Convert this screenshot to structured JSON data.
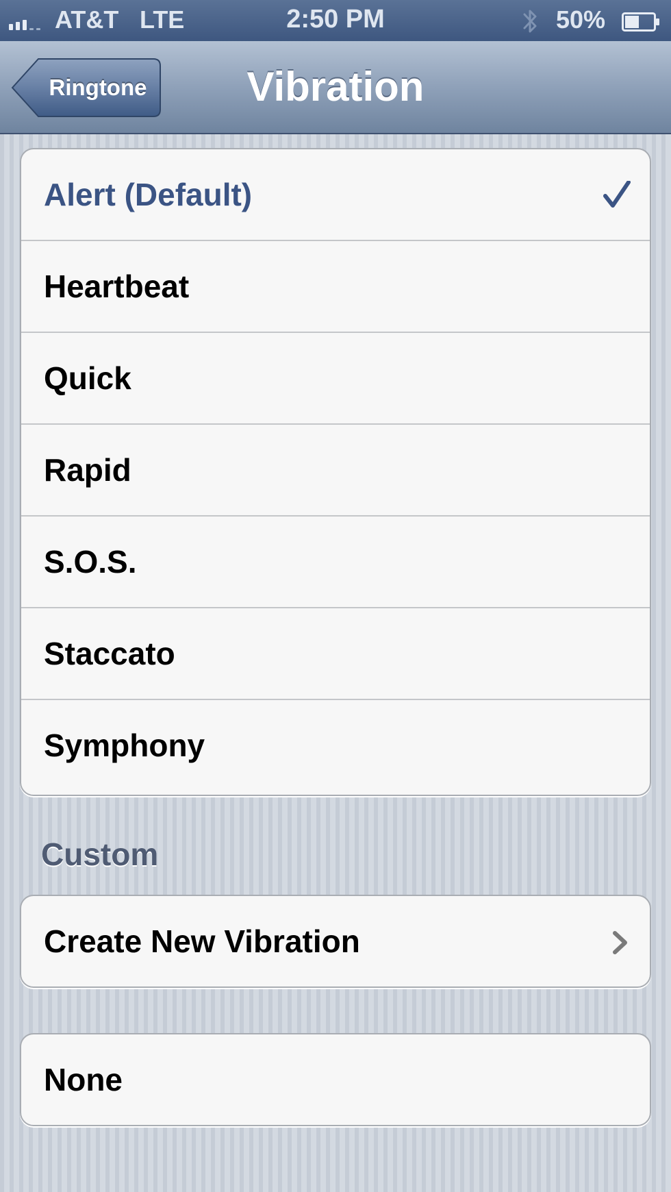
{
  "status_bar": {
    "carrier": "AT&T",
    "network": "LTE",
    "time": "2:50 PM",
    "battery_percent": "50%",
    "battery_level": 0.5,
    "signal_bars": 3,
    "icons": [
      "signal-icon",
      "bluetooth-icon",
      "battery-icon"
    ]
  },
  "nav": {
    "back_label": "Ringtone",
    "title": "Vibration"
  },
  "standard": {
    "items": [
      {
        "label": "Alert (Default)",
        "selected": true
      },
      {
        "label": "Heartbeat",
        "selected": false
      },
      {
        "label": "Quick",
        "selected": false
      },
      {
        "label": "Rapid",
        "selected": false
      },
      {
        "label": "S.O.S.",
        "selected": false
      },
      {
        "label": "Staccato",
        "selected": false
      },
      {
        "label": "Symphony",
        "selected": false
      }
    ]
  },
  "custom": {
    "header": "Custom",
    "create_label": "Create New Vibration"
  },
  "none": {
    "label": "None"
  },
  "colors": {
    "selected_text": "#3b5484",
    "nav_gradient_top": "#b3c1d3",
    "status_bar": "#3e5780"
  }
}
